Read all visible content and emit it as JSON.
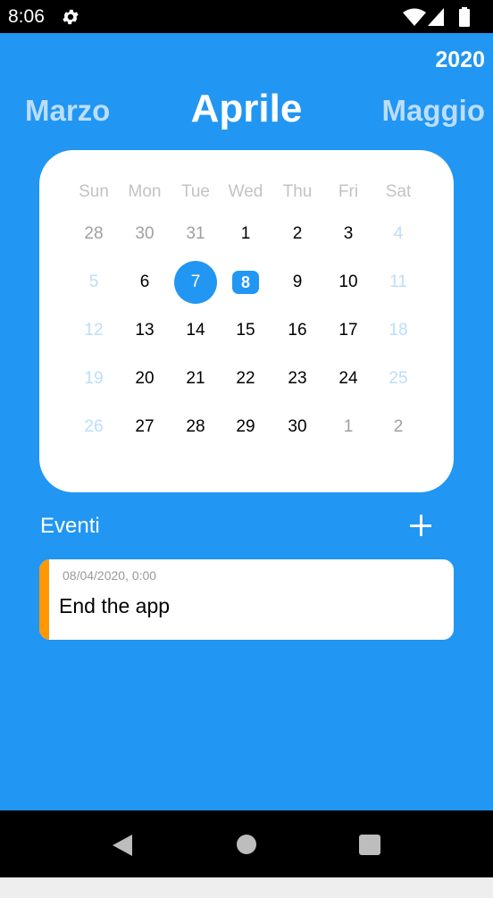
{
  "status_bar": {
    "time": "8:06",
    "icons": [
      "gear-icon",
      "wifi-icon",
      "signal-icon",
      "battery-icon"
    ]
  },
  "header": {
    "year": "2020",
    "prev_month": "Marzo",
    "current_month": "Aprile",
    "next_month": "Maggio"
  },
  "calendar": {
    "weekdays": [
      "Sun",
      "Mon",
      "Tue",
      "Wed",
      "Thu",
      "Fri",
      "Sat"
    ],
    "weeks": [
      [
        "28",
        "30",
        "31",
        "1",
        "2",
        "3",
        "4"
      ],
      [
        "5",
        "6",
        "7",
        "8",
        "9",
        "10",
        "11"
      ],
      [
        "12",
        "13",
        "14",
        "15",
        "16",
        "17",
        "18"
      ],
      [
        "19",
        "20",
        "21",
        "22",
        "23",
        "24",
        "25"
      ],
      [
        "26",
        "27",
        "28",
        "29",
        "30",
        "1",
        "2"
      ]
    ],
    "selected_day": "7",
    "today": "8"
  },
  "events": {
    "title": "Eventi",
    "add_icon": "plus-icon",
    "items": [
      {
        "datetime": "08/04/2020,  0:00",
        "title": "End the app",
        "accent_color": "#ff9800"
      }
    ]
  },
  "colors": {
    "primary": "#2196f3",
    "light_blue": "#bbdefb",
    "accent": "#ff9800"
  },
  "nav_bar": {
    "icons": [
      "back-icon",
      "home-icon",
      "recents-icon"
    ]
  }
}
